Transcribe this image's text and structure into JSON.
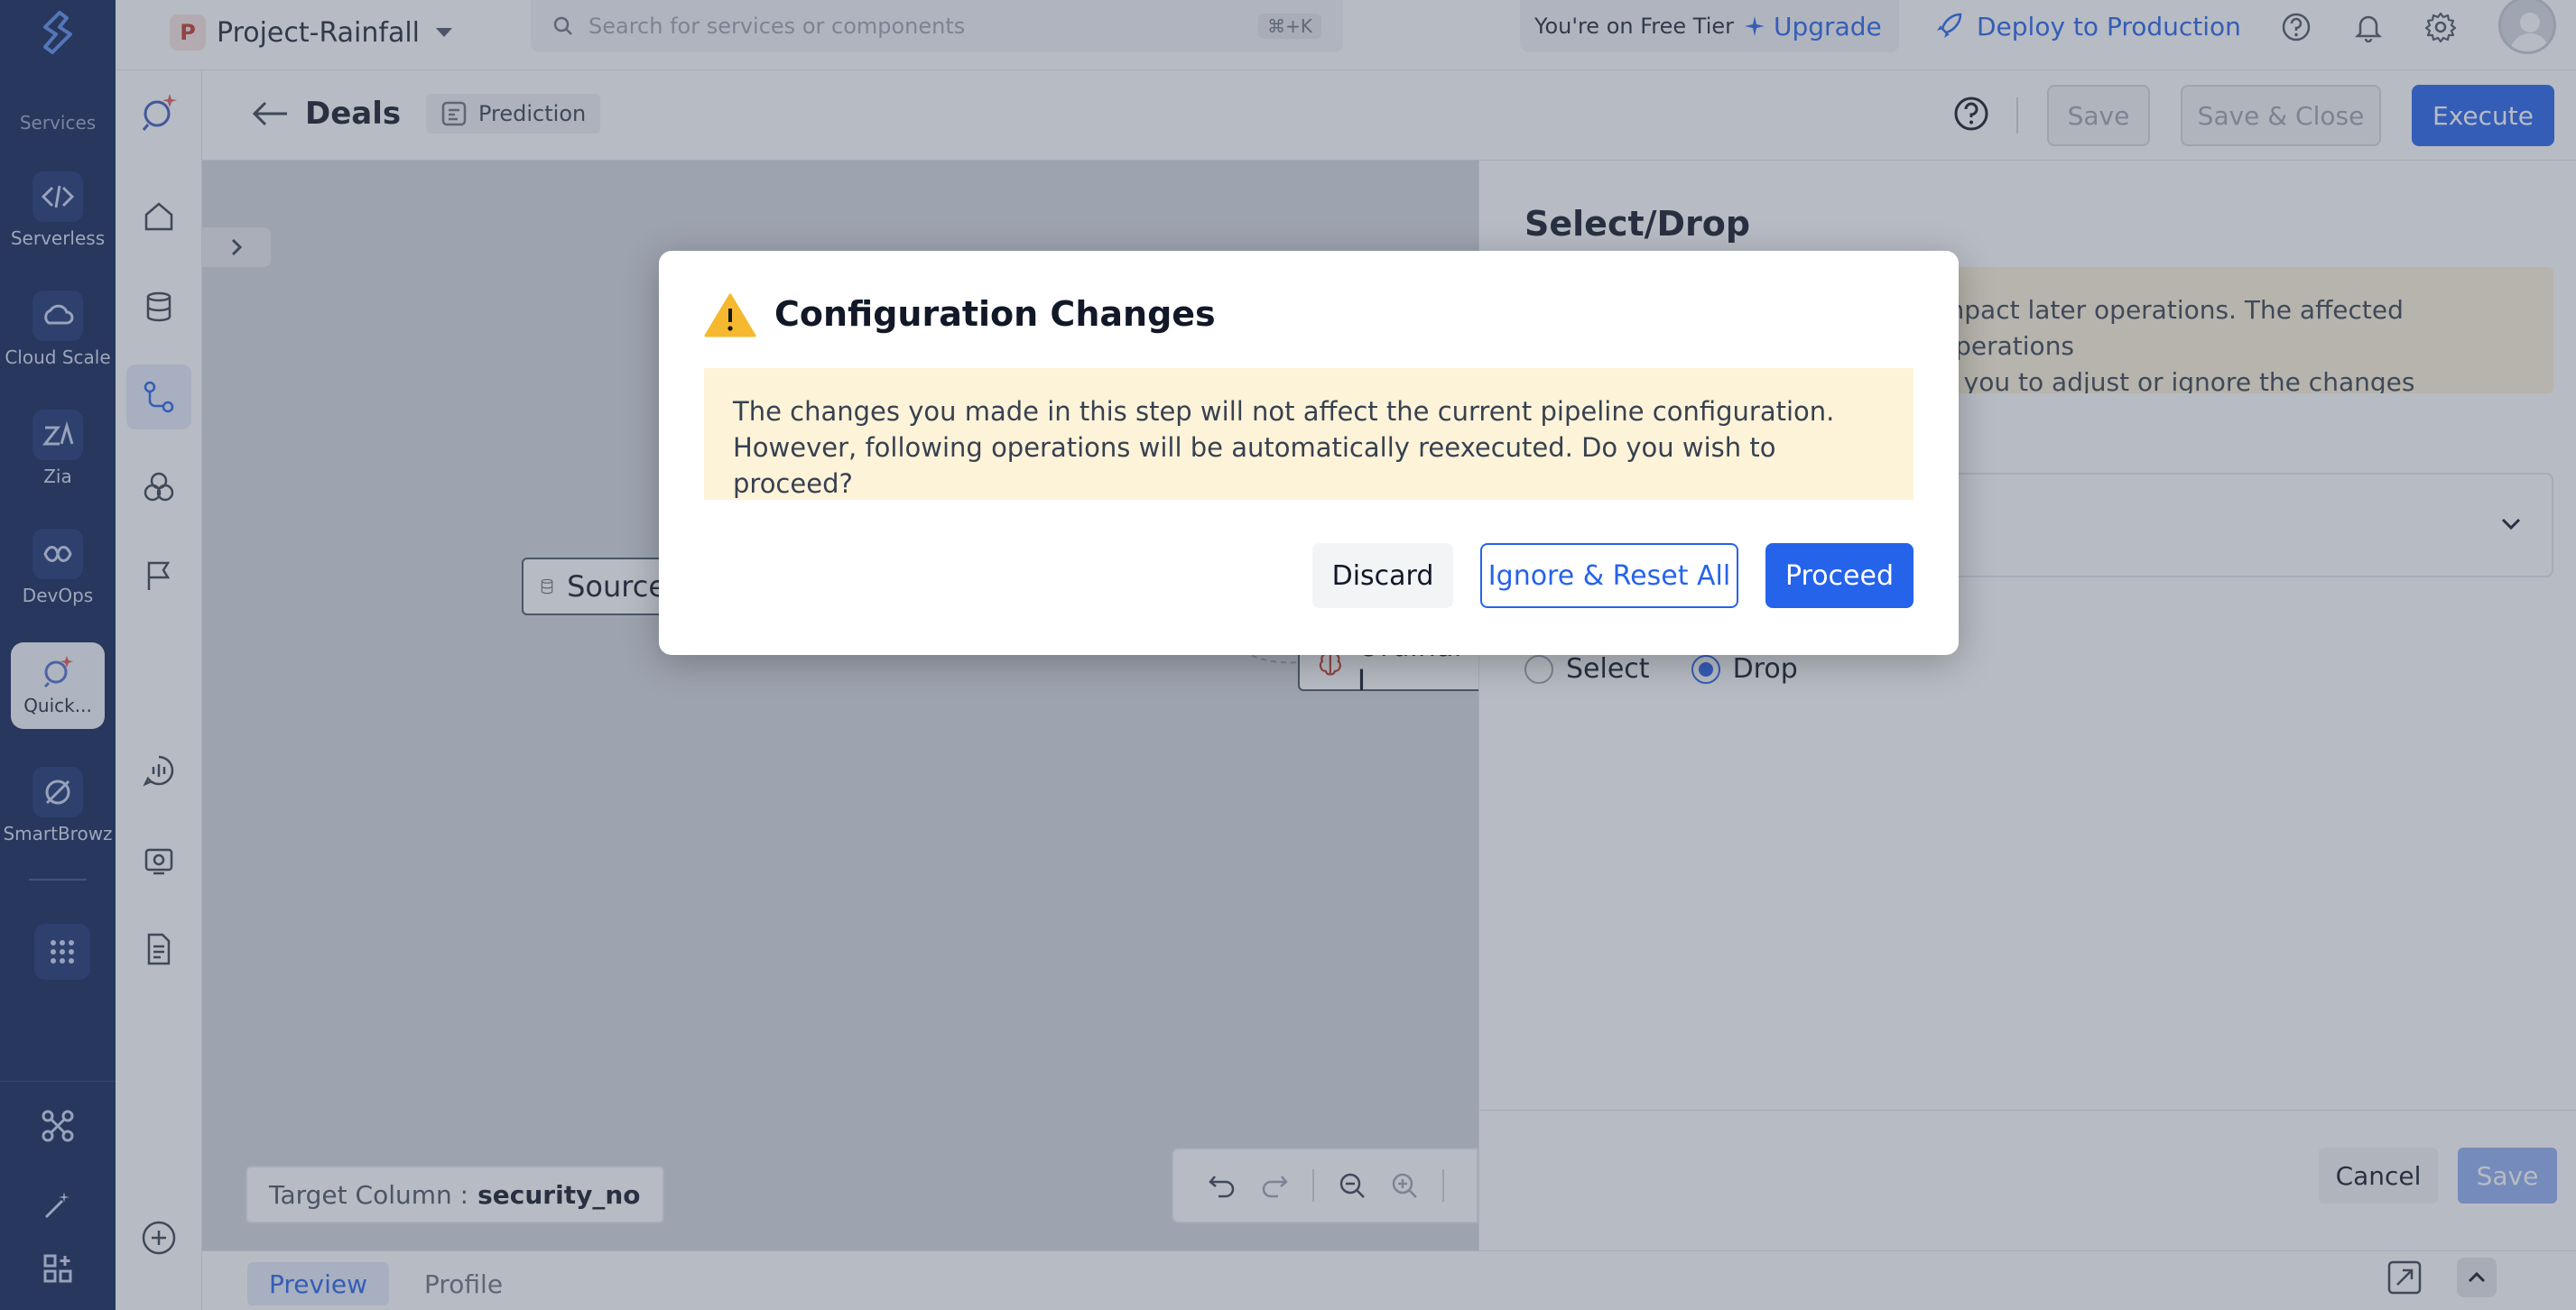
{
  "services": {
    "title": "Services",
    "items": [
      {
        "label": "Serverless",
        "icon": "serverless-icon"
      },
      {
        "label": "Cloud Scale",
        "icon": "cloud-scale-icon"
      },
      {
        "label": "Zia",
        "icon": "zia-icon"
      },
      {
        "label": "DevOps",
        "icon": "devops-icon"
      },
      {
        "label": "Quick...",
        "icon": "quickml-icon"
      },
      {
        "label": "SmartBrowz",
        "icon": "smartbrowz-icon"
      }
    ],
    "active_index": 4
  },
  "header": {
    "project_initial": "P",
    "project_name": "Project-Rainfall",
    "search_placeholder": "Search for services or components",
    "search_shortcut": "⌘+K",
    "tier_text": "You're on Free Tier",
    "upgrade_label": "Upgrade",
    "deploy_label": "Deploy to Production"
  },
  "subheader": {
    "back_title": "Deals",
    "chip_label": "Prediction",
    "save_label": "Save",
    "save_close_label": "Save & Close",
    "execute_label": "Execute"
  },
  "canvas": {
    "source_node_label": "Source",
    "ordinal_node_label": "Ordinal I",
    "target_label": "Target Column :",
    "target_value": "security_no"
  },
  "bottom_tabs": [
    {
      "label": "Preview",
      "active": true
    },
    {
      "label": "Profile",
      "active": false
    }
  ],
  "panel": {
    "title": "Select/Drop",
    "warning_line1": "mpact later operations. The affected operations",
    "warning_line2": "g you to adjust or ignore the changes",
    "radio_select": "Select",
    "radio_drop": "Drop",
    "selected": "Drop",
    "cancel_label": "Cancel",
    "save_label": "Save"
  },
  "modal": {
    "title": "Configuration Changes",
    "body": "The changes you made in this step will not affect the current pipeline configuration. However, following operations will be automatically reexecuted. Do you wish to proceed?",
    "discard_label": "Discard",
    "ignore_label": "Ignore & Reset All",
    "proceed_label": "Proceed"
  },
  "colors": {
    "accent": "#2563eb",
    "sidebar": "#0f2356",
    "warning_bg": "#fdf3d9",
    "warning_icon": "#f5b82e"
  }
}
